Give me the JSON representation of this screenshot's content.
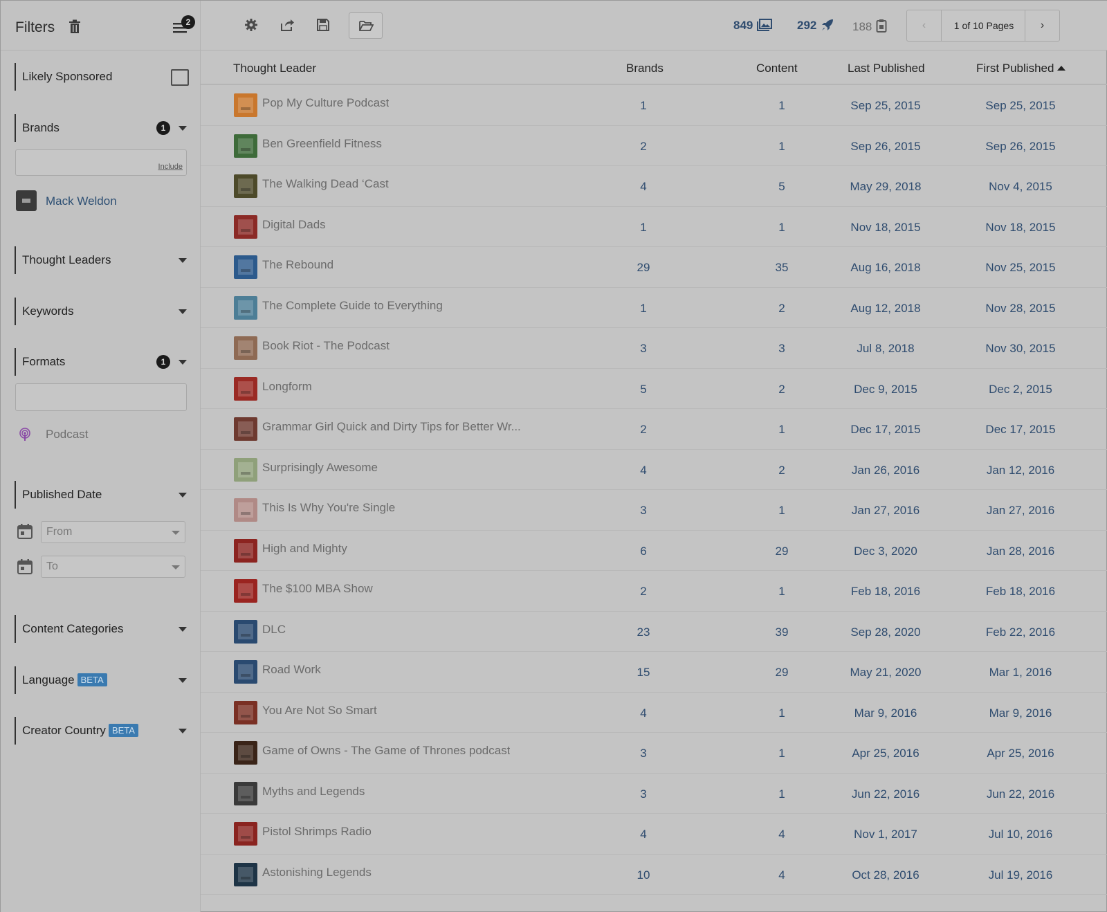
{
  "sidebar": {
    "title": "Filters",
    "menu_badge": "2",
    "likely_sponsored": {
      "label": "Likely Sponsored"
    },
    "brands": {
      "label": "Brands",
      "count": "1",
      "include_label": "Include",
      "selected": "Mack Weldon"
    },
    "thought_leaders": {
      "label": "Thought Leaders"
    },
    "keywords": {
      "label": "Keywords"
    },
    "formats": {
      "label": "Formats",
      "count": "1",
      "selected": "Podcast"
    },
    "published_date": {
      "label": "Published Date",
      "from_placeholder": "From",
      "to_placeholder": "To"
    },
    "content_categories": {
      "label": "Content Categories"
    },
    "language": {
      "label": "Language",
      "badge": "BETA"
    },
    "creator_country": {
      "label": "Creator Country",
      "badge": "BETA"
    }
  },
  "toolbar": {
    "images_count": "849",
    "rocket_count": "292",
    "clipboard_count": "188",
    "pager": {
      "prev": "‹",
      "label": "1 of 10 Pages",
      "next": "›"
    }
  },
  "table": {
    "headers": {
      "thought_leader": "Thought Leader",
      "brands": "Brands",
      "content": "Content",
      "last_published": "Last Published",
      "first_published": "First Published"
    },
    "rows": [
      {
        "name": "Pop My Culture Podcast",
        "brands": "1",
        "content": "1",
        "last": "Sep 25, 2015",
        "first": "Sep 25, 2015",
        "thumb": "#c9772d"
      },
      {
        "name": "Ben Greenfield Fitness",
        "brands": "2",
        "content": "1",
        "last": "Sep 26, 2015",
        "first": "Sep 26, 2015",
        "thumb": "#3e6b3a"
      },
      {
        "name": "The Walking Dead ‘Cast",
        "brands": "4",
        "content": "5",
        "last": "May 29, 2018",
        "first": "Nov 4, 2015",
        "thumb": "#4d4a2a"
      },
      {
        "name": "Digital Dads",
        "brands": "1",
        "content": "1",
        "last": "Nov 18, 2015",
        "first": "Nov 18, 2015",
        "thumb": "#8b2a26"
      },
      {
        "name": "The Rebound",
        "brands": "29",
        "content": "35",
        "last": "Aug 16, 2018",
        "first": "Nov 25, 2015",
        "thumb": "#2c5a8c"
      },
      {
        "name": "The Complete Guide to Everything",
        "brands": "1",
        "content": "2",
        "last": "Aug 12, 2018",
        "first": "Nov 28, 2015",
        "thumb": "#4d7e96"
      },
      {
        "name": "Book Riot - The Podcast",
        "brands": "3",
        "content": "3",
        "last": "Jul 8, 2018",
        "first": "Nov 30, 2015",
        "thumb": "#8e6a54"
      },
      {
        "name": "Longform",
        "brands": "5",
        "content": "2",
        "last": "Dec 9, 2015",
        "first": "Dec 2, 2015",
        "thumb": "#9a2a24"
      },
      {
        "name": "Grammar Girl Quick and Dirty Tips for Better Wr...",
        "brands": "2",
        "content": "1",
        "last": "Dec 17, 2015",
        "first": "Dec 17, 2015",
        "thumb": "#6e3a30"
      },
      {
        "name": "Surprisingly Awesome",
        "brands": "4",
        "content": "2",
        "last": "Jan 26, 2016",
        "first": "Jan 12, 2016",
        "thumb": "#8fa07a"
      },
      {
        "name": "This Is Why You're Single",
        "brands": "3",
        "content": "1",
        "last": "Jan 27, 2016",
        "first": "Jan 27, 2016",
        "thumb": "#b08a86"
      },
      {
        "name": "High and Mighty",
        "brands": "6",
        "content": "29",
        "last": "Dec 3, 2020",
        "first": "Jan 28, 2016",
        "thumb": "#8c2420"
      },
      {
        "name": "The $100 MBA Show",
        "brands": "2",
        "content": "1",
        "last": "Feb 18, 2016",
        "first": "Feb 18, 2016",
        "thumb": "#9a2420"
      },
      {
        "name": "DLC",
        "brands": "23",
        "content": "39",
        "last": "Sep 28, 2020",
        "first": "Feb 22, 2016",
        "thumb": "#2a4a70"
      },
      {
        "name": "Road Work",
        "brands": "15",
        "content": "29",
        "last": "May 21, 2020",
        "first": "Mar 1, 2016",
        "thumb": "#2a4a70"
      },
      {
        "name": "You Are Not So Smart",
        "brands": "4",
        "content": "1",
        "last": "Mar 9, 2016",
        "first": "Mar 9, 2016",
        "thumb": "#7a3024"
      },
      {
        "name": "Game of Owns - The Game of Thrones podcast",
        "brands": "3",
        "content": "1",
        "last": "Apr 25, 2016",
        "first": "Apr 25, 2016",
        "thumb": "#3a2418"
      },
      {
        "name": "Myths and Legends",
        "brands": "3",
        "content": "1",
        "last": "Jun 22, 2016",
        "first": "Jun 22, 2016",
        "thumb": "#3a3a3a"
      },
      {
        "name": "Pistol Shrimps Radio",
        "brands": "4",
        "content": "4",
        "last": "Nov 1, 2017",
        "first": "Jul 10, 2016",
        "thumb": "#8a2420"
      },
      {
        "name": "Astonishing Legends",
        "brands": "10",
        "content": "4",
        "last": "Oct 28, 2016",
        "first": "Jul 19, 2016",
        "thumb": "#1e3446"
      }
    ]
  }
}
